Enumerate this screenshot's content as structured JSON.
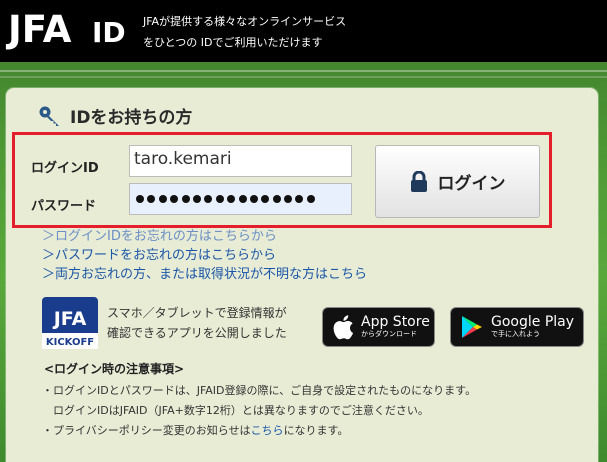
{
  "header": {
    "logo_text": "JFA",
    "logo_id": "ID",
    "tagline_line1": "JFAが提供する様々なオンラインサービス",
    "tagline_line2": "をひとつの IDでご利用いただけます"
  },
  "panel": {
    "title": "IDをお持ちの方",
    "login_id_label": "ログインID",
    "password_label": "パスワード",
    "login_id_value": "taro.kemari",
    "password_length": 16,
    "login_button_label": "ログイン"
  },
  "links": {
    "forgot_id": "＞ログインIDをお忘れの方はこちらから",
    "forgot_password": "＞パスワードをお忘れの方はこちらから",
    "forgot_both": "＞両方お忘れの方、または取得状況が不明な方はこちら"
  },
  "app": {
    "logo_top": "JFA",
    "logo_bottom": "KICKOFF",
    "text_line1": "スマホ／タブレットで登録情報が",
    "text_line2": "確認できるアプリを公開しました",
    "app_store_main": "App Store",
    "app_store_sub": "からダウンロード",
    "google_play_main": "Google Play",
    "google_play_sub": "で手に入れよう"
  },
  "notes": {
    "title": "<ログイン時の注意事項>",
    "line1": "・ログインIDとパスワードは、JFAID登録の際に、ご自身で設定されたものになります。",
    "line2": "　ログインIDはJFAID（JFA+数字12桁）とは異なりますのでご注意ください。",
    "line3_prefix": "・プライバシーポリシー変更のお知らせは",
    "line3_link": "こちら",
    "line3_suffix": "になります。"
  },
  "colors": {
    "accent_red": "#e41e2b",
    "link_blue": "#1a56a8",
    "panel_bg": "#e8ecd5",
    "header_bg": "#000000"
  }
}
